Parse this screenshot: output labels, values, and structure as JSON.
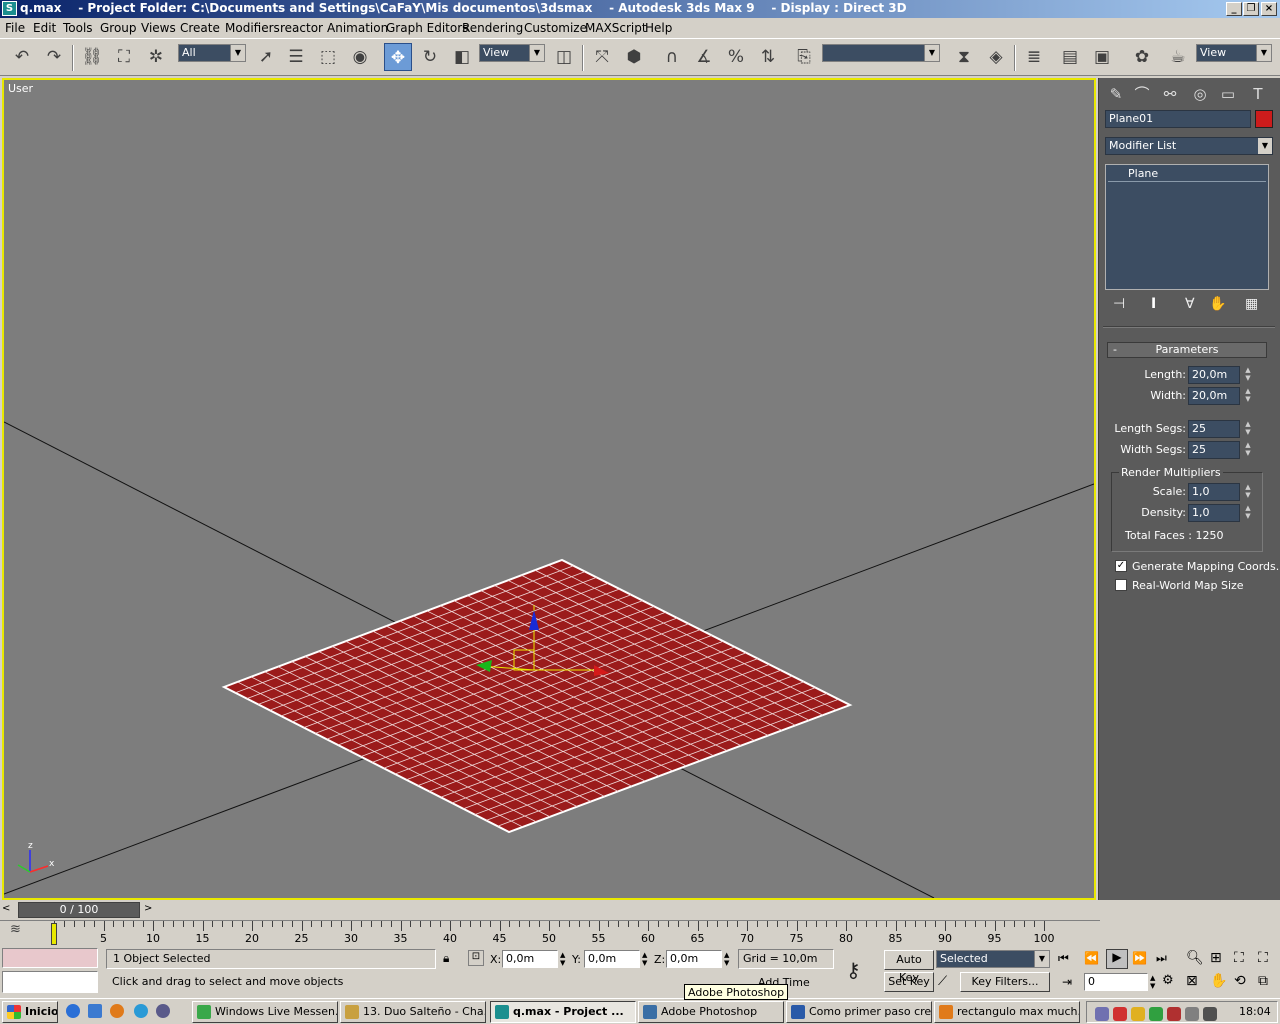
{
  "window": {
    "app_icon": "3dsmax-icon",
    "title": "q.max    - Project Folder: C:\\Documents and Settings\\CaFaY\\Mis documentos\\3dsmax    - Autodesk 3ds Max 9    - Display : Direct 3D"
  },
  "menu": [
    "File",
    "Edit",
    "Tools",
    "Group",
    "Views",
    "Create",
    "Modifiers",
    "reactor",
    "Animation",
    "Graph Editors",
    "Rendering",
    "Customize",
    "MAXScript",
    "Help"
  ],
  "toolbar": {
    "selection_filter": "All",
    "reference_coord": "View",
    "named_selection": "",
    "render_type": "View"
  },
  "viewport": {
    "label": "User",
    "axis_labels": {
      "x": "x",
      "z": "z"
    },
    "object_color": "#9b1b1b",
    "background_color": "#7d7d7d",
    "border_color": "#e8e800"
  },
  "command_panel": {
    "object_name": "Plane01",
    "object_color": "#cc1c1c",
    "modifier_list_label": "Modifier List",
    "stack_items": [
      "Plane"
    ],
    "rollout_title": "Parameters",
    "rollout_toggle": "-",
    "params": {
      "length_label": "Length:",
      "length": "20,0m",
      "width_label": "Width:",
      "width": "20,0m",
      "length_segs_label": "Length Segs:",
      "length_segs": "25",
      "width_segs_label": "Width Segs:",
      "width_segs": "25",
      "render_multipliers_label": "Render Multipliers",
      "scale_label": "Scale:",
      "scale": "1,0",
      "density_label": "Density:",
      "density": "1,0",
      "total_faces": "Total Faces : 1250",
      "gen_mapping_label": "Generate Mapping Coords.",
      "gen_mapping_checked": true,
      "real_world_label": "Real-World Map Size",
      "real_world_checked": false
    }
  },
  "timeline": {
    "frame_display": "0 / 100",
    "ticks": [
      "5",
      "10",
      "15",
      "20",
      "25",
      "30",
      "35",
      "40",
      "45",
      "50",
      "55",
      "60",
      "65",
      "70",
      "75",
      "80",
      "85",
      "90",
      "95",
      "100"
    ],
    "current_frame": 0,
    "total_frames": 100
  },
  "status": {
    "selection_info": "1 Object Selected",
    "prompt": "Click and drag to select and move objects",
    "x_label": "X:",
    "x_value": "0,0m",
    "y_label": "Y:",
    "y_value": "0,0m",
    "z_label": "Z:",
    "z_value": "0,0m",
    "grid": "Grid = 10,0m",
    "time_tag": "Add Time Tag",
    "auto_key": "Auto Key",
    "set_key": "Set Key",
    "key_mode": "Selected",
    "key_filters": "Key Filters...",
    "frame_field": "0",
    "tooltip": "Adobe Photoshop"
  },
  "taskbar": {
    "start_label": "Inicio",
    "tasks": [
      "Windows Live Messen...",
      "13. Duo Salteño - Cha...",
      "q.max    - Project ...",
      "Adobe Photoshop",
      "Como primer paso cre...",
      "rectangulo max much..."
    ],
    "active_task_index": 2,
    "clock": "18:04"
  }
}
